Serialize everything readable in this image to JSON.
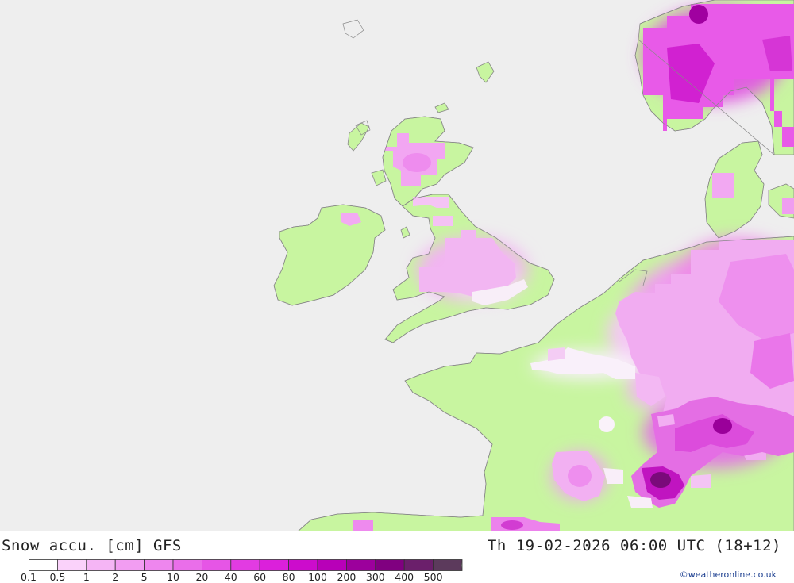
{
  "map": {
    "ocean_color": "#eeeeee",
    "land_color": "#c8f5a0",
    "coast_color": "#888888"
  },
  "header": {
    "title": "Snow accu. [cm] GFS",
    "datetime": "Th 19-02-2026 06:00 UTC (18+12)"
  },
  "legend": {
    "labels": [
      "0.1",
      "0.5",
      "1",
      "2",
      "5",
      "10",
      "20",
      "40",
      "60",
      "80",
      "100",
      "200",
      "300",
      "400",
      "500"
    ],
    "colors": [
      "#ffffff",
      "#fad2fa",
      "#f5b5f5",
      "#f29df2",
      "#ee86ee",
      "#ea6eea",
      "#e655e6",
      "#e23be2",
      "#db20db",
      "#cc0ccc",
      "#b800b8",
      "#9c009c",
      "#800080",
      "#6b1f6b",
      "#5c3a5c"
    ],
    "arrow_color": "#666666"
  },
  "credit": "©weatheronline.co.uk"
}
